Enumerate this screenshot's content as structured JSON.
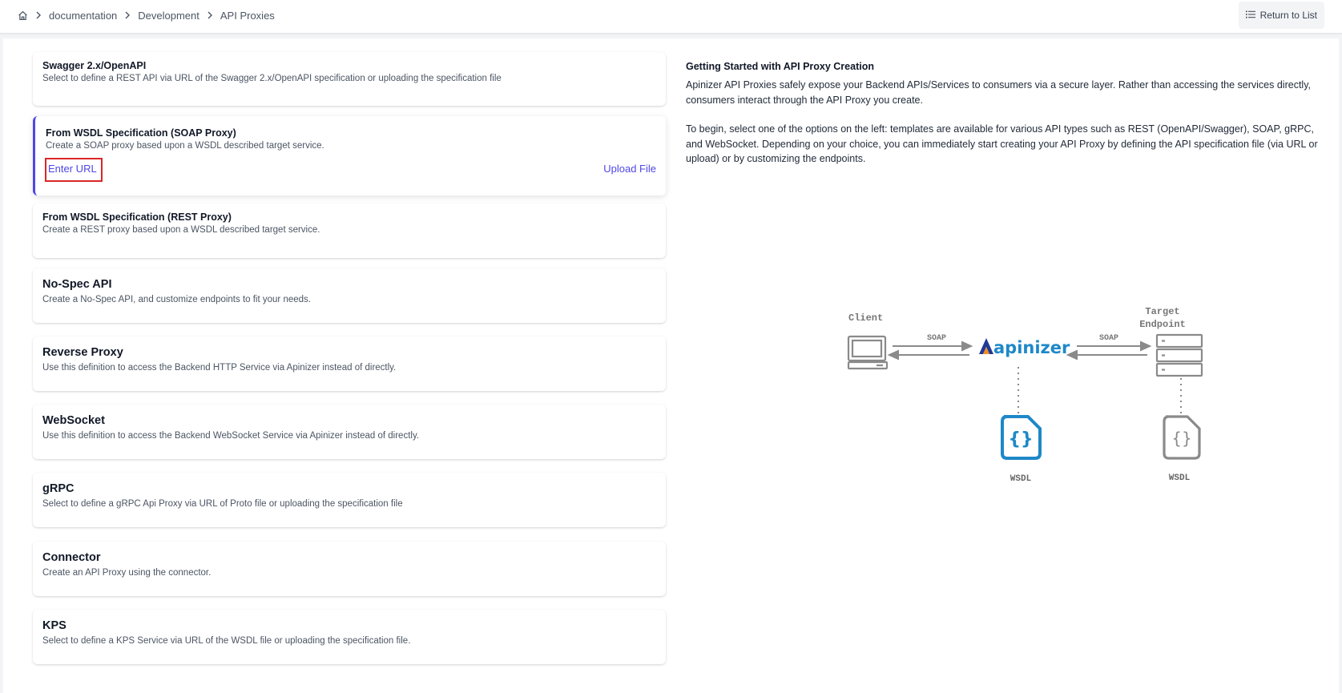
{
  "breadcrumb": {
    "home_icon": "home-icon",
    "items": [
      "documentation",
      "Development",
      "API Proxies"
    ]
  },
  "header": {
    "return_label": "Return to List",
    "return_icon": "list-icon"
  },
  "cards": [
    {
      "title": "Swagger 2.x/OpenAPI",
      "desc": "Select to define a REST API via URL of the Swagger 2.x/OpenAPI specification or uploading the specification file"
    },
    {
      "title": "From WSDL Specification (SOAP Proxy)",
      "desc": "Create a SOAP proxy based upon a WSDL described target service.",
      "enter_url": "Enter URL",
      "upload_file": "Upload File"
    },
    {
      "title": "From WSDL Specification (REST Proxy)",
      "desc": "Create a REST proxy based upon a WSDL described target service."
    },
    {
      "title": "No-Spec API",
      "desc": "Create a No-Spec API, and customize endpoints to fit your needs."
    },
    {
      "title": "Reverse Proxy",
      "desc": "Use this definition to access the Backend HTTP Service via Apinizer instead of directly."
    },
    {
      "title": "WebSocket",
      "desc": "Use this definition to access the Backend WebSocket Service via Apinizer instead of directly."
    },
    {
      "title": "gRPC",
      "desc": "Select to define a gRPC Api Proxy via URL of Proto file or uploading the specification file"
    },
    {
      "title": "Connector",
      "desc": "Create an API Proxy using the connector."
    },
    {
      "title": "KPS",
      "desc": "Select to define a KPS Service via URL of the WSDL file or uploading the specification file."
    }
  ],
  "info": {
    "title": "Getting Started with API Proxy Creation",
    "p1": "Apinizer API Proxies safely expose your Backend APIs/Services to consumers via a secure layer. Rather than accessing the services directly, consumers interact through the API Proxy you create.",
    "p2": "To begin, select one of the options on the left: templates are available for various API types such as REST (OpenAPI/Swagger), SOAP, gRPC, and WebSocket. Depending on your choice, you can immediately start creating your API Proxy by defining the API specification file (via URL or upload) or by customizing the endpoints."
  },
  "diagram": {
    "client_label": "Client",
    "target_label_1": "Target",
    "target_label_2": "Endpoint",
    "protocol_left": "SOAP",
    "protocol_right": "SOAP",
    "logo_text": "apinizer",
    "wsdl_left": "WSDL",
    "wsdl_right": "WSDL",
    "colors": {
      "accent_blue": "#1e88c8",
      "logo_orange": "#f28c28",
      "logo_navy": "#1f3a93",
      "gray": "#8a8a8a"
    }
  },
  "colors": {
    "link": "#4f46e5",
    "highlight_border": "#dc2626"
  }
}
